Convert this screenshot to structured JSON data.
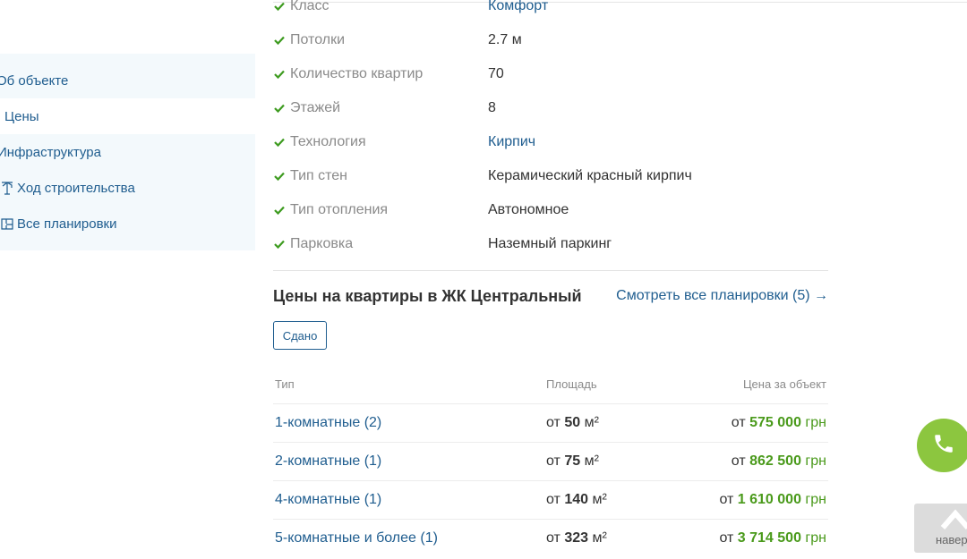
{
  "sidebar": {
    "items": [
      {
        "label": "Об объекте",
        "icon": "info-icon"
      },
      {
        "label": "Цены",
        "icon": "price-icon"
      },
      {
        "label": "Инфраструктура",
        "icon": "infrastructure-icon"
      },
      {
        "label": "Ход строительства",
        "icon": "crane-icon"
      },
      {
        "label": "Все планировки",
        "icon": "floorplan-icon"
      }
    ]
  },
  "props": {
    "rows": [
      {
        "label": "Класс",
        "value": "Комфорт"
      },
      {
        "label": "Потолки",
        "value": "2.7 м"
      },
      {
        "label": "Количество квартир",
        "value": "70"
      },
      {
        "label": "Этажей",
        "value": "8"
      },
      {
        "label": "Технология",
        "value": "Кирпич"
      },
      {
        "label": "Тип стен",
        "value": "Керамический красный кирпич"
      },
      {
        "label": "Тип отопления",
        "value": "Автономное"
      },
      {
        "label": "Парковка",
        "value": "Наземный паркинг"
      }
    ]
  },
  "prices": {
    "title": "Цены на квартиры в ЖК Центральный",
    "view_all": "Смотреть все планировки (5) →",
    "filter_tag": "Сдано",
    "headers": {
      "type": "Тип",
      "area": "Площадь",
      "price": "Цена за объект"
    },
    "rows": [
      {
        "type": "1-комнатные (2)",
        "area_prefix": "от",
        "area": "50",
        "area_unit": "м²",
        "price_prefix": "от",
        "price": "575 000",
        "currency": "грн"
      },
      {
        "type": "2-комнатные (1)",
        "area_prefix": "от",
        "area": "75",
        "area_unit": "м²",
        "price_prefix": "от",
        "price": "862 500",
        "currency": "грн"
      },
      {
        "type": "4-комнатные (1)",
        "area_prefix": "от",
        "area": "140",
        "area_unit": "м²",
        "price_prefix": "от",
        "price": "1 610 000",
        "currency": "грн"
      },
      {
        "type": "5-комнатные и более (1)",
        "area_prefix": "от",
        "area": "323",
        "area_unit": "м²",
        "price_prefix": "от",
        "price": "3 714 500",
        "currency": "грн"
      }
    ]
  },
  "floating": {
    "call_icon": "phone-icon",
    "up_label": "навер",
    "up_icon": "arrow-up-icon"
  },
  "colors": {
    "link": "#1f5d8f",
    "accent_green": "#8cc63f",
    "price_green": "#4a9a1b",
    "sidebar_bg": "#f3f9fc"
  }
}
